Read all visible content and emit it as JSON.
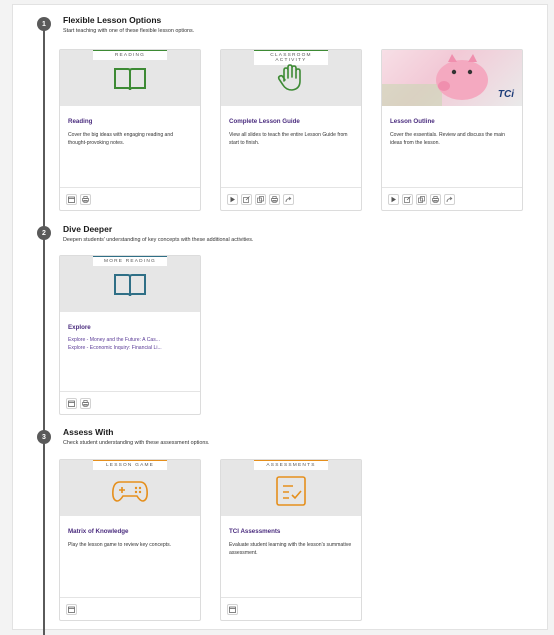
{
  "sections": [
    {
      "number": "1",
      "title": "Flexible Lesson Options",
      "description": "Start teaching with one of these flexible lesson options.",
      "cards": [
        {
          "tag": "READING",
          "tag_color": "#3d8a34",
          "icon": "book-icon",
          "title": "Reading",
          "description": "Cover the big ideas with engaging reading and thought-provoking notes.",
          "tools": [
            "calendar-icon",
            "print-icon"
          ]
        },
        {
          "tag": "CLASSROOM ACTIVITY",
          "tag_color": "#3d8a34",
          "icon": "hand-icon",
          "title": "Complete Lesson Guide",
          "description": "View all slides to teach the entire Lesson Guide from start to finish.",
          "tools": [
            "play-icon",
            "edit-icon",
            "copy-icon",
            "print-icon",
            "share-icon"
          ]
        },
        {
          "tag": "",
          "icon": "piggy-bank-image",
          "logo": "TCi",
          "title": "Lesson Outline",
          "description": "Cover the essentials. Review and discuss the main ideas from the lesson.",
          "tools": [
            "play-icon",
            "edit-icon",
            "copy-icon",
            "print-icon",
            "share-icon"
          ]
        }
      ]
    },
    {
      "number": "2",
      "title": "Dive Deeper",
      "description": "Deepen students' understanding of key concepts with these additional activities.",
      "cards": [
        {
          "tag": "MORE READING",
          "tag_color": "#2f6f86",
          "icon": "book-icon",
          "title": "Explore",
          "links": [
            "Explore - Money and the Future: A Cas...",
            "Explore - Economic Inquiry: Financial Li..."
          ],
          "tools": [
            "calendar-icon",
            "print-icon"
          ]
        }
      ]
    },
    {
      "number": "3",
      "title": "Assess With",
      "description": "Check student understanding with these assessment options.",
      "cards": [
        {
          "tag": "LESSON GAME",
          "tag_color": "#e58f1c",
          "icon": "gamepad-icon",
          "title": "Matrix of Knowledge",
          "description": "Play the lesson game to review key concepts.",
          "tools": [
            "calendar-icon"
          ]
        },
        {
          "tag": "ASSESSMENTS",
          "tag_color": "#e58f1c",
          "icon": "checklist-icon",
          "title": "TCI Assessments",
          "description": "Evaluate student learning with the lesson's summative assessment.",
          "tools": [
            "calendar-icon"
          ]
        }
      ]
    }
  ]
}
